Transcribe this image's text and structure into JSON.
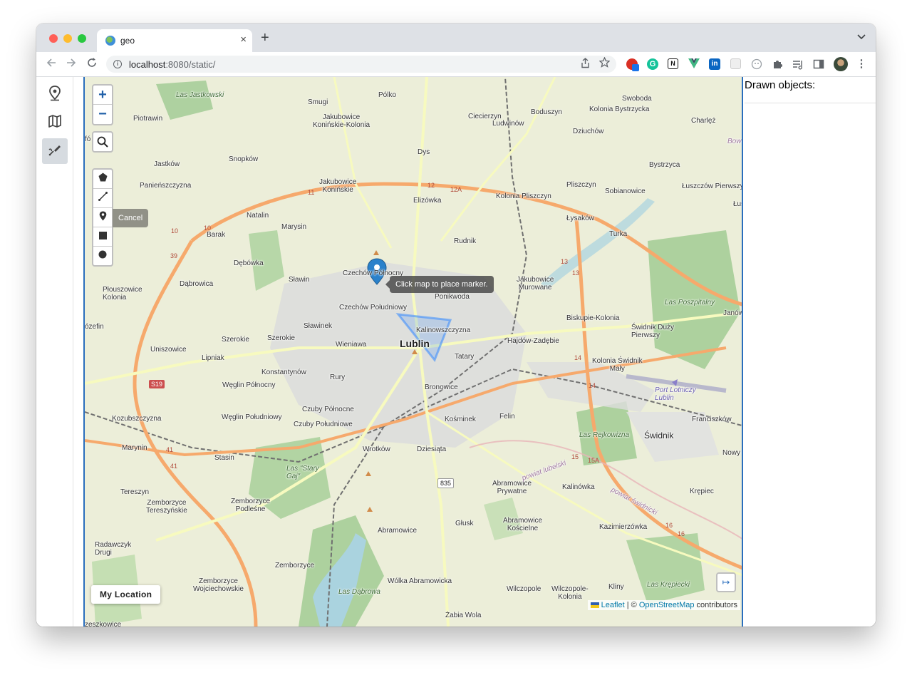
{
  "browser": {
    "tab_title": "geo",
    "url_host": "localhost",
    "url_rest": ":8080/static/",
    "new_tab_label": "+",
    "tab_close_label": "×"
  },
  "sidebar": {
    "items": [
      {
        "name": "map-pin-icon",
        "active": false
      },
      {
        "name": "map-icon",
        "active": false
      },
      {
        "name": "draw-tools-icon",
        "active": true
      }
    ]
  },
  "map": {
    "zoom_in": "+",
    "zoom_out": "−",
    "cancel_label": "Cancel",
    "tooltip": "Click map to place marker.",
    "my_location": "My Location",
    "collapse_label": "↦",
    "attribution": {
      "leaflet": "Leaflet",
      "separator": " | © ",
      "osm": "OpenStreetMap",
      "suffix": " contributors"
    },
    "labels": {
      "lublin": "Lublin",
      "kalinowszczyzna": "Kalinowszczyzna",
      "czechow_polnocny": "Czechów Północny",
      "czechow_poludniowy": "Czechów Południowy",
      "slawin": "Sławin",
      "slawinek": "Sławinek",
      "wieniawa": "Wieniawa",
      "szerokie": "Szerokie",
      "szerokie2": "Szerokie",
      "konstantynow": "Konstantynów",
      "rury": "Rury",
      "weglin_polnocny": "Węglin Północny",
      "weglin_poludniowy": "Węglin Południowy",
      "czuby_polnocne": "Czuby Północne",
      "czuby_poludniowe": "Czuby Południowe",
      "bronowice": "Bronowice",
      "kosminek": "Kośminek",
      "felin": "Felin",
      "tatary": "Tatary",
      "hajdow": "Hajdów-Zadębie",
      "ponikwoda": "Ponikwoda",
      "wrotkow": "Wrotków",
      "dziesiata": "Dziesiąta",
      "abramowice": "Abramowice",
      "glusk": "Głusk",
      "zemborzyce": "Zemborzyce",
      "swidnik": "Świdnik",
      "rudnik": "Rudnik",
      "elizowka": "Elizówka",
      "dys": "Dys",
      "marysin": "Marysin",
      "natalin": "Natalin",
      "barak": "Barak",
      "debowka": "Dębówka",
      "dabrowica": "Dąbrowica",
      "ploszowice": "Płouszowice\nKolonia",
      "uniszowice": "Uniszowice",
      "lipniak": "Lipniak",
      "kozubszczyzna": "Kozubszczyzna",
      "marynin": "Marynin",
      "stasin": "Stasin",
      "tereszyn": "Tereszyn",
      "radawczyk": "Radawczyk\nDrugi",
      "jastkow": "Jastków",
      "snopkow": "Snopków",
      "panienszczyzna": "Panieńszczyzna",
      "piotrawin": "Piotrawin",
      "smugi": "Smugi",
      "polko": "Pólko",
      "jakubowice_kk": "Jakubowice\nKonińskie-Kolonia",
      "jakubowice_k": "Jakubowice\nKonińskie",
      "ciecierzyn": "Ciecierzyn",
      "ludwinow": "Ludwinów",
      "boduszyn": "Boduszyn",
      "dziuchow": "Dziuchów",
      "swoboda": "Swoboda",
      "kolonia_bystrzycka": "Kolonia Bystrzycka",
      "charlez": "Charlęż",
      "bystrzyca": "Bystrzyca",
      "pliszczyn": "Pliszczyn",
      "kolonia_pliszczyn": "Kolonia Pliszczyn",
      "sobianowice": "Sobianowice",
      "luszczow": "Łuszczów Pierwszy",
      "lysakow": "Łysaków",
      "turka": "Turka",
      "jakubowice_murowane": "Jakubowice\nMurowane",
      "biskupie": "Biskupie-Kolonia",
      "swidnik_duzy": "Świdnik Duży\nPierwszy",
      "kolonia_swidnik": "Kolonia Świdnik\nMały",
      "port_lotniczy": "Port Lotniczy\nLublin",
      "franciszkow": "Franciszków",
      "nowy_k": "Nowy K",
      "las_poszpitalny": "Las Poszpitalny",
      "janow": "Janów",
      "las_rejkowizna": "Las Rejkowizna",
      "krepiec": "Krępiec",
      "kazimierzowka": "Kazimierzówka",
      "kalinowka": "Kalinówka",
      "abramowice_prywatne": "Abramowice\nPrywatne",
      "abramowice_koscielne": "Abramowice\nKościelne",
      "wolka_abramowicka": "Wólka Abramowicka",
      "wilczopole": "Wilczopole",
      "wilczopole_kolonia": "Wilczopole-\nKolonia",
      "kliny": "Kliny",
      "las_krepiecki": "Las Krępiecki",
      "zabia_wola": "Żabia Wola",
      "las_dabrowa": "Las Dąbrowa",
      "zemborzyce_wojc": "Zemborzyce\nWojciechowskie",
      "zemborzyce_tereszynskie": "Zemborzyce\nTereszyńskie",
      "zemborzyce_podlesne": "Zemborzyce\nPodleśne",
      "las_stary_gaj": "Las \"Stary\nGaj\"",
      "las_jastkowski": "Las Jastkowski",
      "lublin_road": "Lublin",
      "zeszkowice": "zeszkowice",
      "bozefin": "ózefin",
      "fo_echa": "fó  echa",
      "lus": "Łus",
      "dowiat_lubelski": "powiat lubelski",
      "powiat_swidnicki": "powiat świdnicki",
      "bow": "Bow"
    },
    "roads": {
      "s19": "S19",
      "r835": "835",
      "r12": "12",
      "r12a": "12A",
      "r10": "10",
      "r10b": "10",
      "r11": "11",
      "r39": "39",
      "r41": "41",
      "r41b": "41",
      "r13": "13",
      "r13b": "13",
      "r14": "14",
      "r14b": "14",
      "r15": "15",
      "r15a": "15A",
      "r16": "16",
      "r16b": "16"
    }
  },
  "panel": {
    "title": "Drawn objects:"
  },
  "colors": {
    "accent": "#2a6ebd",
    "marker": "#2a81cb",
    "shape": "#3388ff"
  }
}
